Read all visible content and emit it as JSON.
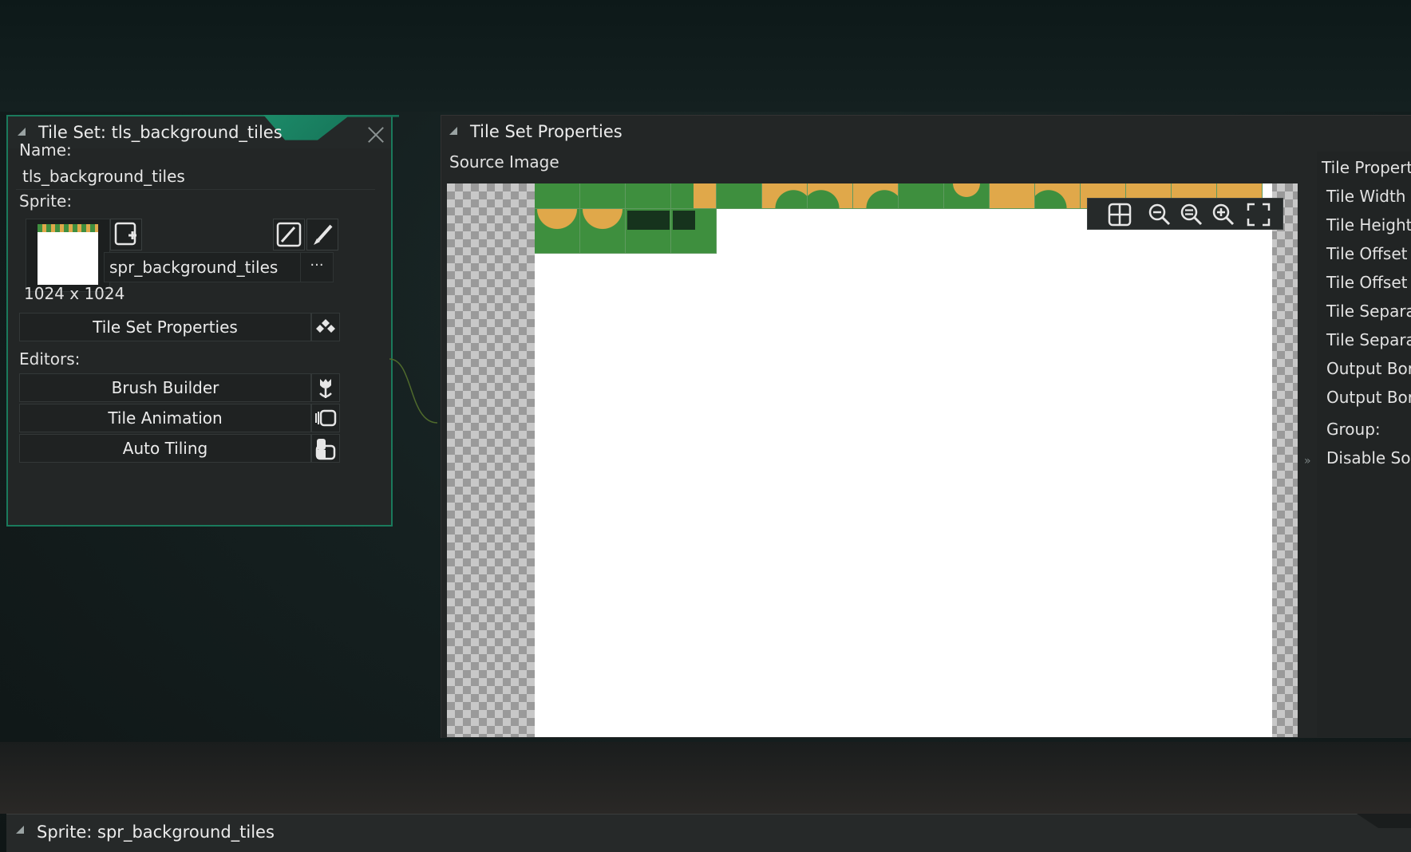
{
  "tileset_window": {
    "title": "Tile Set: tls_background_tiles",
    "name_label": "Name:",
    "name_value": "tls_background_tiles",
    "sprite_label": "Sprite:",
    "sprite_name": "spr_background_tiles",
    "sprite_dimensions": "1024 x 1024",
    "more_button": "···",
    "tile_set_properties_button": "Tile Set Properties",
    "editors_label": "Editors:",
    "editors": [
      "Brush Builder",
      "Tile Animation",
      "Auto Tiling"
    ]
  },
  "properties_window": {
    "title": "Tile Set Properties",
    "source_image_label": "Source Image",
    "tile_properties_heading": "Tile Propert",
    "properties": [
      "Tile Width",
      "Tile Height",
      "Tile Offset X",
      "Tile Offset Y",
      "Tile Separa",
      "Tile Separa",
      "Output Bor",
      "Output Bor"
    ],
    "group_label": "Group:",
    "disable_source_label": "Disable Sou",
    "expander": "»"
  },
  "sprite_window": {
    "title": "Sprite: spr_background_tiles"
  },
  "colors": {
    "accent_green": "#1c8a68",
    "panel_bg": "#232626",
    "grass": "#3e8f3e",
    "sand": "#e0a84a"
  }
}
